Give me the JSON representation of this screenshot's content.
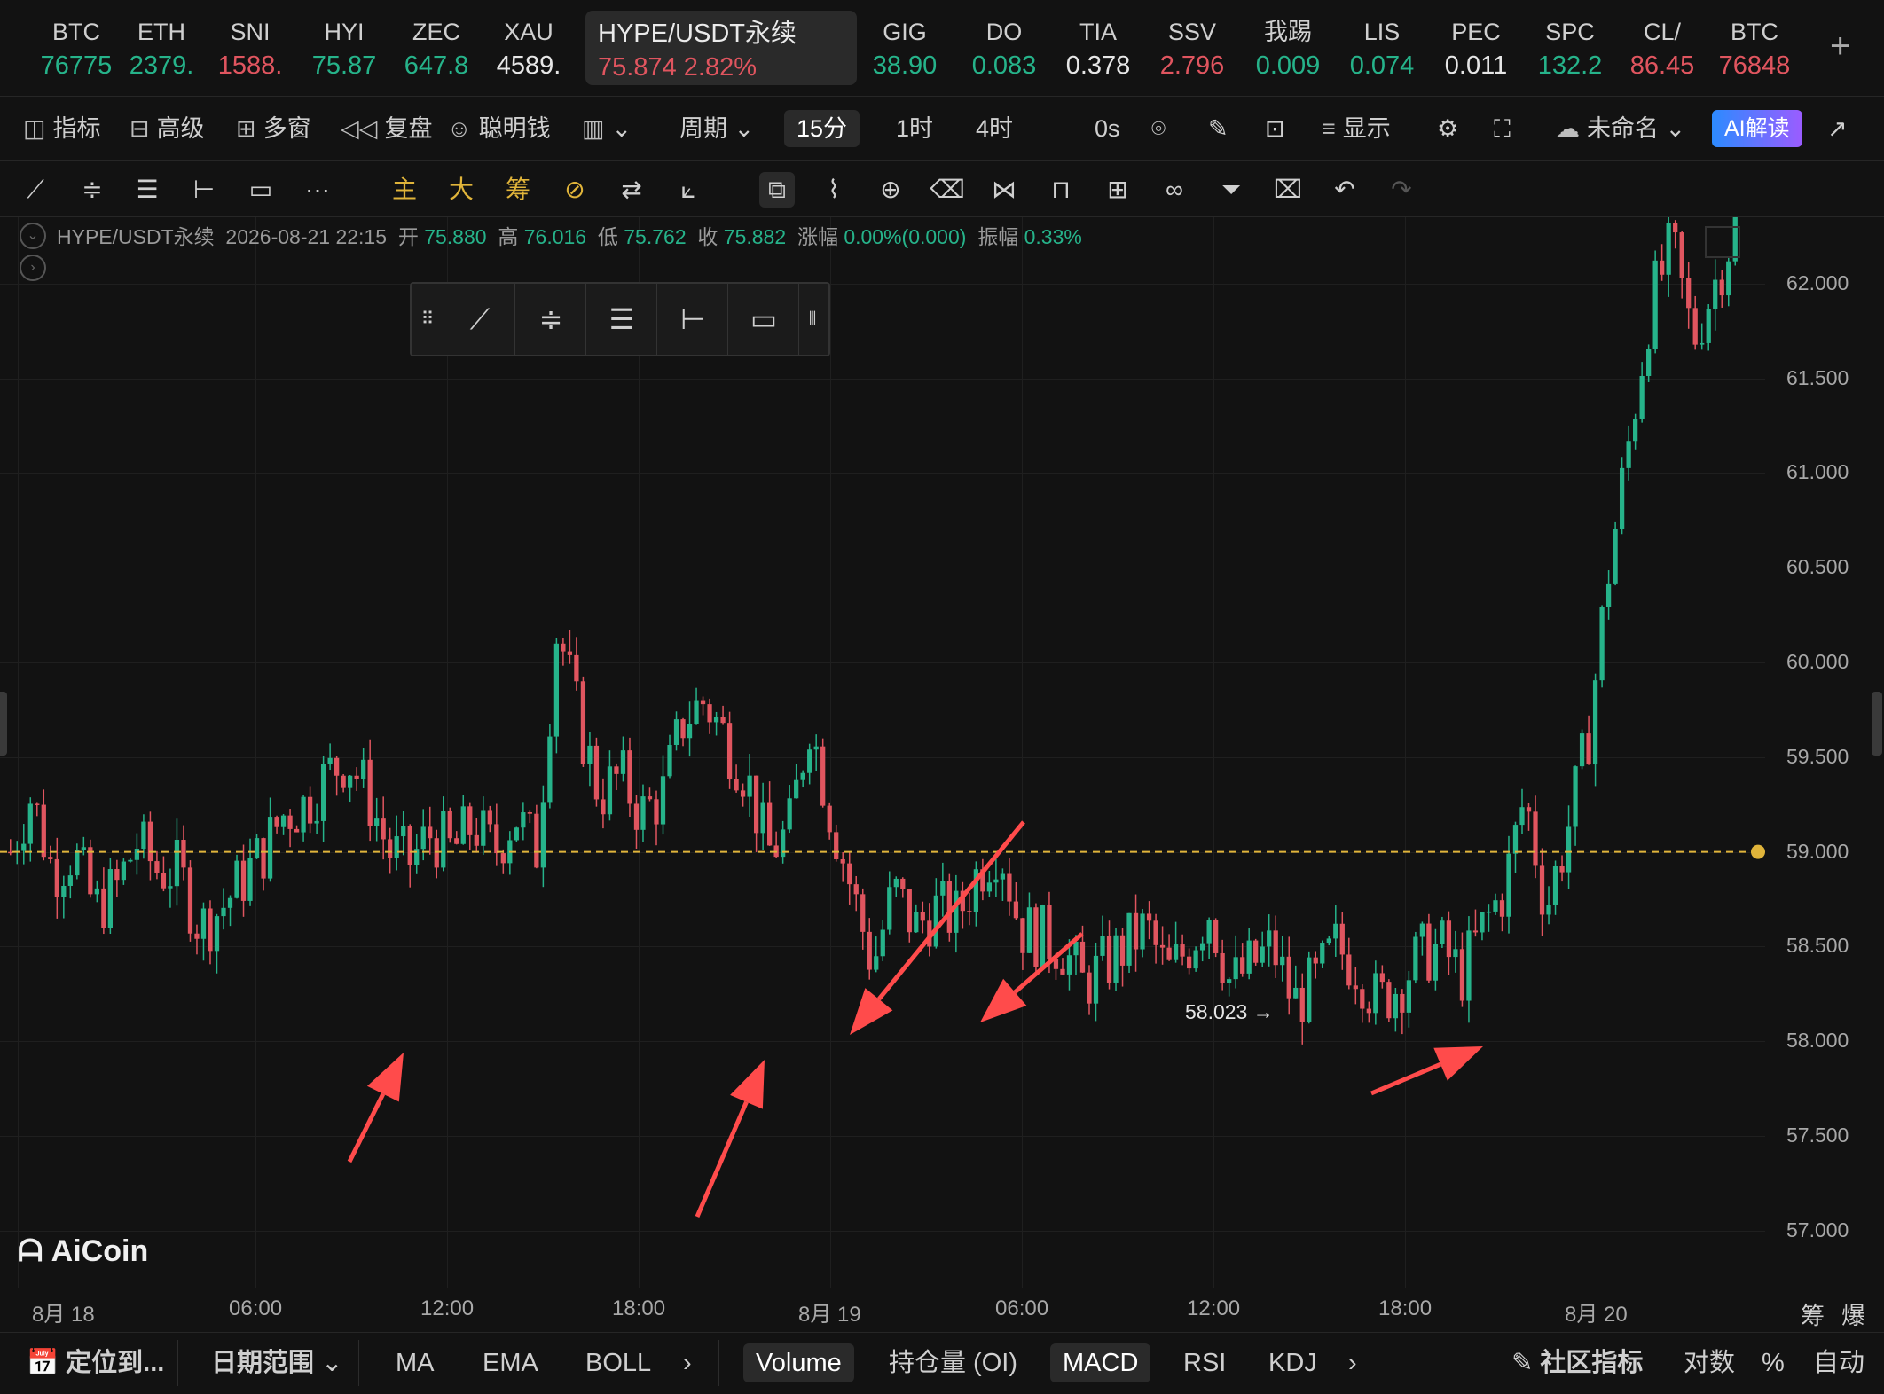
{
  "tickers": [
    {
      "sym": "BTC",
      "px": "76775",
      "color": "#26b38a"
    },
    {
      "sym": "ETH",
      "px": "2379.",
      "color": "#26b38a"
    },
    {
      "sym": "SNI",
      "px": "1588.",
      "color": "#e0555f"
    },
    {
      "sym": "HYI",
      "px": "75.87",
      "color": "#26b38a"
    },
    {
      "sym": "ZEC",
      "px": "647.8",
      "color": "#26b38a"
    },
    {
      "sym": "XAU",
      "px": "4589.",
      "color": "#e6e6e6"
    },
    {
      "sym": "GIG",
      "px": "38.90",
      "color": "#26b38a"
    },
    {
      "sym": "DO",
      "px": "0.083",
      "color": "#26b38a"
    },
    {
      "sym": "TIA",
      "px": "0.378",
      "color": "#e6e6e6"
    },
    {
      "sym": "SSV",
      "px": "2.796",
      "color": "#e0555f"
    },
    {
      "sym": "我踢",
      "px": "0.009",
      "color": "#26b38a"
    },
    {
      "sym": "LIS",
      "px": "0.074",
      "color": "#26b38a"
    },
    {
      "sym": "PEC",
      "px": "0.011",
      "color": "#e6e6e6"
    },
    {
      "sym": "SPC",
      "px": "132.2",
      "color": "#26b38a"
    },
    {
      "sym": "CL/",
      "px": "86.45",
      "color": "#e0555f"
    },
    {
      "sym": "BTC",
      "px": "76848",
      "color": "#e0555f"
    }
  ],
  "active_ticker": {
    "sym": "HYPE/USDT永续",
    "px": "75.874",
    "chg": "2.82%",
    "color": "#e0555f"
  },
  "toolbar": {
    "indicators": "指标",
    "advanced": "高级",
    "multi": "多窗",
    "replay": "复盘",
    "smart": "聪明钱",
    "period": "周期",
    "p15": "15分",
    "p1h": "1时",
    "p4h": "4时",
    "countdown": "0s",
    "display": "显示",
    "layout": "未命名",
    "ai": "AI解读"
  },
  "draw_tools": {
    "main": "主",
    "big": "大",
    "chips": "筹",
    "more": "···"
  },
  "info": {
    "pair": "HYPE/USDT永续",
    "time": "2026-08-21 22:15",
    "open_l": "开",
    "open": "75.880",
    "high_l": "高",
    "high": "76.016",
    "low_l": "低",
    "low": "75.762",
    "close_l": "收",
    "close": "75.882",
    "chg_l": "涨幅",
    "chg": "0.00%(0.000)",
    "amp_l": "振幅",
    "amp": "0.33%"
  },
  "y_axis": [
    "62.000",
    "61.500",
    "61.000",
    "60.500",
    "60.000",
    "59.500",
    "59.000",
    "58.500",
    "58.000",
    "57.500",
    "57.000"
  ],
  "x_axis": [
    "8月 18",
    "06:00",
    "12:00",
    "18:00",
    "8月 19",
    "06:00",
    "12:00",
    "18:00",
    "8月 20"
  ],
  "low_marker": "58.023 →",
  "brand": "AiCoin",
  "corner": {
    "chips": "筹",
    "burst": "爆"
  },
  "bottom": {
    "locate": "定位到...",
    "range": "日期范围",
    "ma": "MA",
    "ema": "EMA",
    "boll": "BOLL",
    "volume": "Volume",
    "oi": "持仓量 (OI)",
    "macd": "MACD",
    "rsi": "RSI",
    "kdj": "KDJ",
    "community": "社区指标",
    "log": "对数",
    "pct": "%",
    "auto": "自动"
  },
  "colors": {
    "up": "#26b38a",
    "down": "#e0555f",
    "level": "#e0b43a",
    "arrow": "#ff4b4b"
  },
  "level_price": 59.0,
  "chart_data": {
    "type": "candlestick",
    "title": "HYPE/USDT永续 15分",
    "ylim": [
      56.7,
      62.35
    ],
    "ohlc_close_path": [
      59.0,
      59.3,
      58.9,
      59.0,
      58.7,
      58.8,
      59.05,
      58.9,
      58.9,
      58.6,
      58.7,
      58.85,
      59.0,
      59.2,
      59.25,
      59.4,
      59.5,
      59.3,
      59.0,
      58.95,
      59.1,
      59.0,
      59.15,
      59.0,
      59.2,
      59.0,
      60.2,
      59.7,
      59.3,
      59.4,
      59.2,
      59.3,
      59.7,
      59.8,
      59.6,
      59.4,
      59.0,
      59.1,
      59.7,
      59.2,
      58.8,
      58.4,
      58.8,
      58.6,
      58.7,
      58.65,
      58.9,
      59.05,
      58.6,
      58.55,
      58.5,
      58.3,
      58.4,
      58.5,
      58.6,
      58.35,
      58.5,
      58.7,
      58.3,
      58.4,
      58.5,
      58.2,
      58.3,
      58.5,
      58.4,
      58.2,
      58.3,
      58.45,
      58.5,
      58.35,
      58.6,
      58.8,
      59.3,
      58.7,
      59.1,
      59.6,
      60.5,
      61.2,
      61.9,
      62.2,
      61.7,
      62.0,
      62.3
    ]
  }
}
